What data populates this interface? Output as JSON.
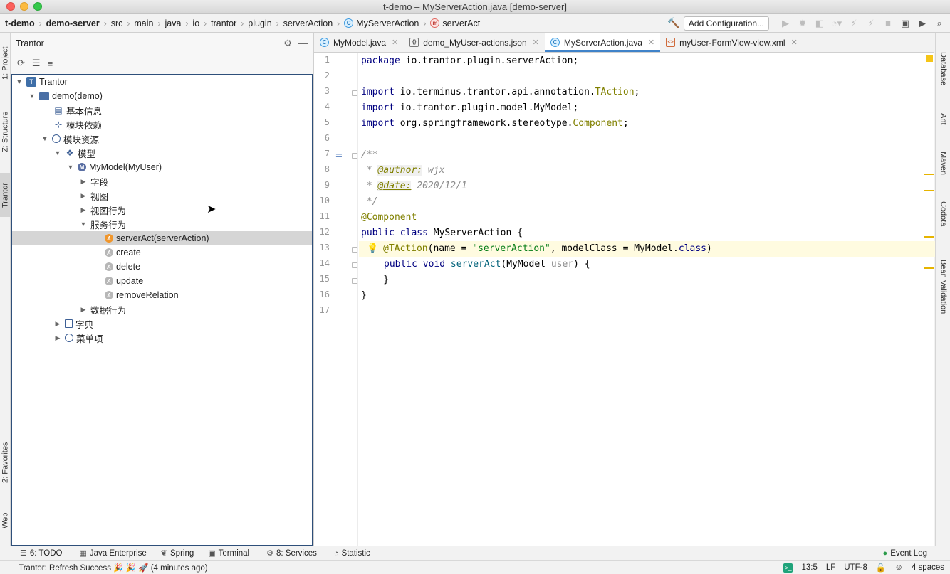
{
  "window": {
    "title": "t-demo – MyServerAction.java [demo-server]"
  },
  "breadcrumbs": [
    {
      "label": "t-demo",
      "bold": true
    },
    {
      "label": "demo-server",
      "bold": true
    },
    {
      "label": "src"
    },
    {
      "label": "main"
    },
    {
      "label": "java"
    },
    {
      "label": "io"
    },
    {
      "label": "trantor"
    },
    {
      "label": "plugin"
    },
    {
      "label": "serverAction"
    },
    {
      "label": "MyServerAction",
      "icon": "C"
    },
    {
      "label": "serverAct",
      "icon": "m"
    }
  ],
  "toolbar": {
    "add_configuration": "Add Configuration..."
  },
  "left_stripe": {
    "project": "1: Project",
    "structure": "Z: Structure",
    "trantor": "Trantor",
    "favorites": "2: Favorites",
    "web": "Web"
  },
  "panel": {
    "title": "Trantor",
    "tree": [
      {
        "label": "Trantor",
        "level": 0,
        "expanded": true,
        "icon": "T"
      },
      {
        "label": "demo(demo)",
        "level": 1,
        "expanded": true,
        "icon": "folder"
      },
      {
        "label": "基本信息",
        "level": 2,
        "icon": "info"
      },
      {
        "label": "模块依赖",
        "level": 2,
        "icon": "module"
      },
      {
        "label": "模块资源",
        "level": 2,
        "expanded": true,
        "icon": "globe"
      },
      {
        "label": "模型",
        "level": 3,
        "expanded": true,
        "icon": "model"
      },
      {
        "label": "MyModel(MyUser)",
        "level": 4,
        "expanded": true,
        "icon": "M"
      },
      {
        "label": "字段",
        "level": 5,
        "collapsed": true
      },
      {
        "label": "视图",
        "level": 5,
        "collapsed": true
      },
      {
        "label": "视图行为",
        "level": 5,
        "collapsed": true
      },
      {
        "label": "服务行为",
        "level": 5,
        "expanded": true
      },
      {
        "label": "serverAct(serverAction)",
        "level": 6,
        "icon": "A-orange",
        "selected": true
      },
      {
        "label": "create",
        "level": 6,
        "icon": "A-grey"
      },
      {
        "label": "delete",
        "level": 6,
        "icon": "A-grey"
      },
      {
        "label": "update",
        "level": 6,
        "icon": "A-grey"
      },
      {
        "label": "removeRelation",
        "level": 6,
        "icon": "A-grey"
      },
      {
        "label": "数据行为",
        "level": 5,
        "collapsed": true
      },
      {
        "label": "字典",
        "level": 3,
        "collapsed": true,
        "icon": "book"
      },
      {
        "label": "菜单项",
        "level": 3,
        "collapsed": true,
        "icon": "menu"
      }
    ]
  },
  "editor": {
    "tabs": [
      {
        "label": "MyModel.java",
        "icon": "C"
      },
      {
        "label": "demo_MyUser-actions.json",
        "icon": "json"
      },
      {
        "label": "MyServerAction.java",
        "icon": "C",
        "active": true
      },
      {
        "label": "myUser-FormView-view.xml",
        "icon": "xml"
      }
    ],
    "line_numbers": [
      "1",
      "2",
      "3",
      "4",
      "5",
      "6",
      "7",
      "8",
      "9",
      "10",
      "11",
      "12",
      "13",
      "14",
      "15",
      "16",
      "17"
    ],
    "code": {
      "l1_kw": "package",
      "l1_rest": " io.trantor.plugin.serverAction;",
      "l3_kw": "import",
      "l3_rest": " io.terminus.trantor.api.annotation.",
      "l3_cls": "TAction",
      "l3_end": ";",
      "l4_kw": "import",
      "l4_rest": " io.trantor.plugin.model.MyModel;",
      "l5_kw": "import",
      "l5_rest": " org.springframework.stereotype.",
      "l5_cls": "Component",
      "l5_end": ";",
      "l7": "/**",
      "l8_pre": " * ",
      "l8_tag": "@author:",
      "l8_val": " wjx",
      "l9_pre": " * ",
      "l9_tag": "@date:",
      "l9_val": " 2020/12/1",
      "l10": " */",
      "l11": "@Component",
      "l12_kw": "public class",
      "l12_rest": " MyServerAction {",
      "l13_ann": "@TAction",
      "l13_a": "(name = ",
      "l13_str": "\"serverAction\"",
      "l13_b": ", modelClass = MyModel.",
      "l13_kw": "class",
      "l13_c": ")",
      "l14_kw": "public void",
      "l14_fn": " serverAct",
      "l14_a": "(MyModel ",
      "l14_param": "user",
      "l14_b": ") {",
      "l15": "    }",
      "l16": "}"
    }
  },
  "right_stripe": {
    "database": "Database",
    "ant": "Ant",
    "maven": "Maven",
    "codota": "Codota",
    "bean_validation": "Bean Validation"
  },
  "bottom_tools": [
    {
      "label": "6: TODO"
    },
    {
      "label": "Java Enterprise"
    },
    {
      "label": "Spring"
    },
    {
      "label": "Terminal"
    },
    {
      "label": "8: Services"
    },
    {
      "label": "Statistic"
    }
  ],
  "event_log": "Event Log",
  "status": {
    "message": "Trantor: Refresh Success 🎉 🎉 🚀 (4 minutes ago)",
    "position": "13:5",
    "line_ending": "LF",
    "encoding": "UTF-8",
    "indent": "4 spaces"
  }
}
